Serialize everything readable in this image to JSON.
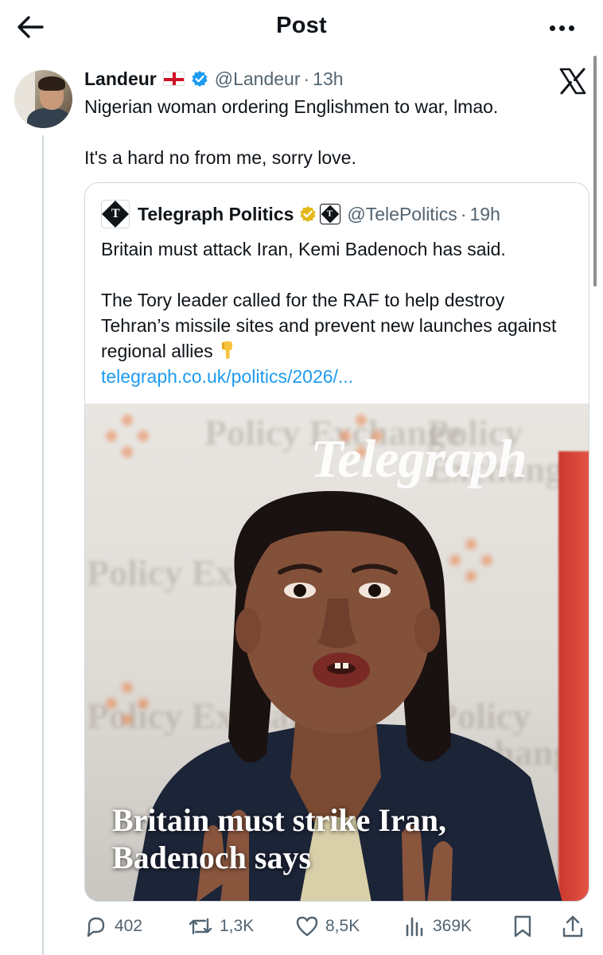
{
  "header": {
    "title": "Post",
    "back_icon": "arrow-left-icon",
    "more_icon": "more-horizontal-icon"
  },
  "post": {
    "author_name": "Landeur",
    "flag": "england-flag-icon",
    "handle": "@Landeur",
    "separator": "·",
    "time": "13h",
    "text_line1": "Nigerian woman ordering Englishmen to war, lmao.",
    "text_line2": "It's a hard no from me, sorry love.",
    "platform_logo": "x-logo"
  },
  "quote": {
    "author_name": "Telegraph Politics",
    "handle": "@TelePolitics",
    "separator": "·",
    "time": "19h",
    "paragraph1": "Britain must attack Iran, Kemi Badenoch has said.",
    "paragraph2": "The Tory leader called for the RAF to help destroy Tehran’s missile sites and prevent new launches against regional allies",
    "link": "telegraph.co.uk/politics/2026/...",
    "image": {
      "watermark": "Telegraph",
      "headline_line1": "Britain must strike Iran,",
      "headline_line2": "Badenoch says",
      "backdrop_text": "Policy Exchange"
    }
  },
  "actions": {
    "replies": "402",
    "reposts": "1,3K",
    "likes": "8,5K",
    "views": "369K"
  },
  "colors": {
    "text": "#0f1419",
    "secondary": "#536471",
    "link": "#1d9bf0",
    "border": "#cfd9de",
    "verified_blue": "#1d9bf0",
    "verified_gold": "#e2b719"
  }
}
